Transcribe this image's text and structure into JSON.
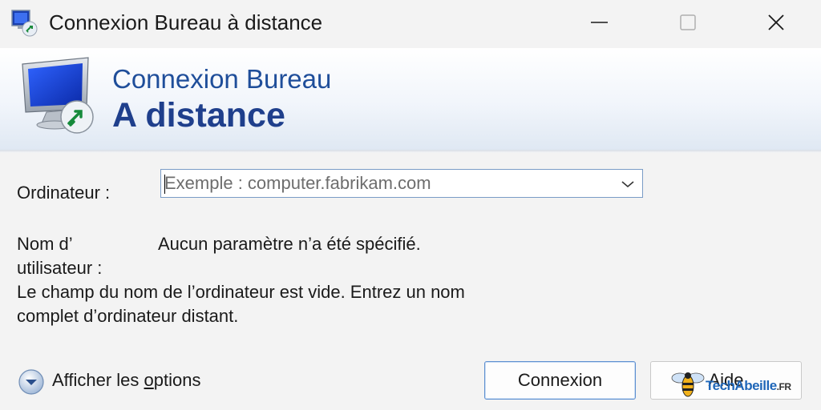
{
  "window": {
    "title": "Connexion Bureau à distance",
    "controls": {
      "minimize_icon": "minimize-icon",
      "maximize_icon": "maximize-icon",
      "close_icon": "close-icon"
    }
  },
  "banner": {
    "line1": "Connexion Bureau",
    "line2": "A distance",
    "icon": "remote-desktop-monitor-icon"
  },
  "form": {
    "computer_label": "Ordinateur :",
    "computer_value": "",
    "computer_placeholder": "Exemple : computer.fabrikam.com",
    "username_label_line1": "Nom d’",
    "username_label_line2": "utilisateur :",
    "username_value": "Aucun paramètre n’a été spécifié.",
    "message_line1": "Le champ du nom de l’ordinateur est vide. Entrez un nom",
    "message_line2": "complet d’ordinateur distant."
  },
  "footer": {
    "options_prefix": "Afficher les ",
    "options_underlined": "o",
    "options_suffix": "ptions",
    "connect_label": "Connexion",
    "help_label": "Aide"
  },
  "watermark": {
    "text": "TechAbeille",
    "suffix": ".FR"
  },
  "colors": {
    "banner_title": "#1f3f8c",
    "input_border": "#7a9cc6",
    "default_button_border": "#5d8fd0"
  }
}
